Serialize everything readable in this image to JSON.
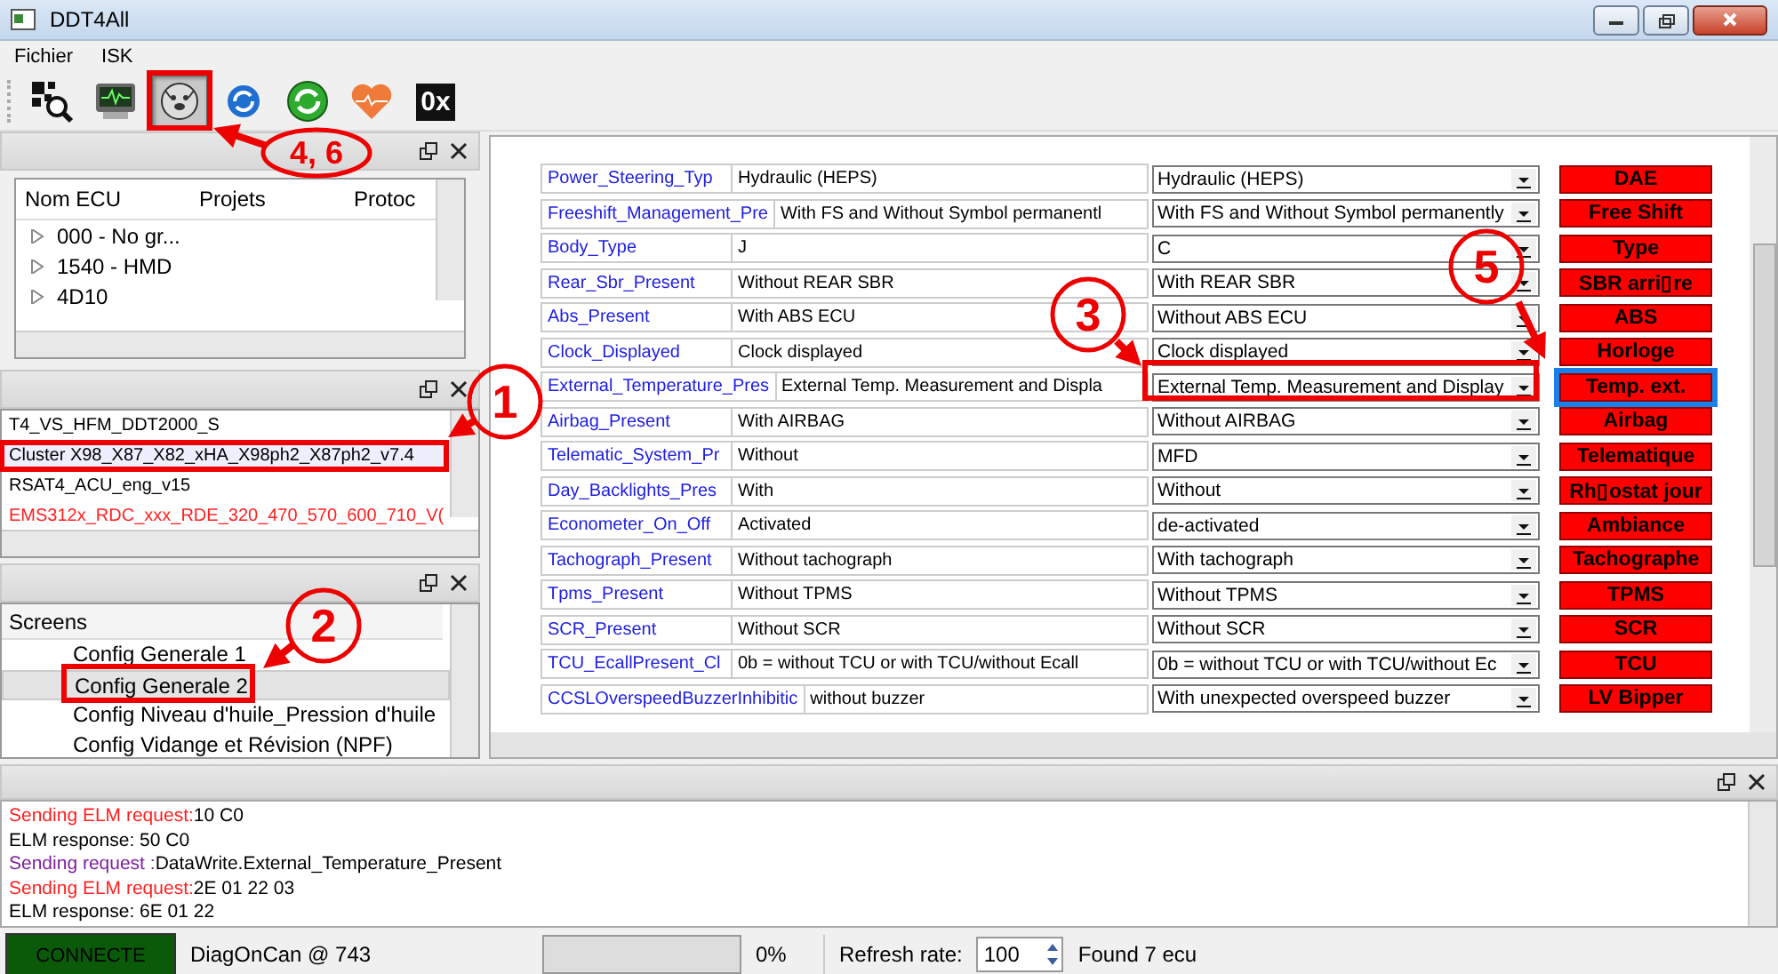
{
  "window": {
    "title": "DDT4All"
  },
  "menu": [
    "Fichier",
    "ISK"
  ],
  "toolbar": [
    {
      "kind": "scan",
      "selected": false
    },
    {
      "kind": "monitor",
      "selected": false
    },
    {
      "kind": "sniffer",
      "selected": true
    },
    {
      "kind": "refresh-blue",
      "selected": false
    },
    {
      "kind": "refresh-green",
      "selected": false
    },
    {
      "kind": "heart",
      "selected": false
    },
    {
      "kind": "hex",
      "label": "0x",
      "selected": false
    }
  ],
  "ecu_tree": {
    "columns": [
      "Nom ECU",
      "Projets",
      "Protoc"
    ],
    "rows": [
      {
        "name": "000 - No gr...",
        "expanded": false
      },
      {
        "name": "1540 - HMD",
        "expanded": false
      },
      {
        "name": "4D10",
        "expanded": false
      }
    ]
  },
  "ecu_files": [
    {
      "text": "T4_VS_HFM_DDT2000_S",
      "selected": false,
      "color": "#000000"
    },
    {
      "text": "Cluster X98_X87_X82_xHA_X98ph2_X87ph2_v7.4",
      "selected": true,
      "color": "#000000"
    },
    {
      "text": "RSAT4_ACU_eng_v15",
      "selected": false,
      "color": "#000000"
    },
    {
      "text": "EMS312x_RDC_xxx_RDE_320_470_570_600_710_V(",
      "selected": false,
      "color": "#ff2020"
    }
  ],
  "screens": {
    "header": "Screens",
    "items": [
      {
        "text": "Config Generale 1",
        "selected": false
      },
      {
        "text": "Config Generale 2",
        "selected": true
      },
      {
        "text": "Config Niveau d'huile_Pression d'huile",
        "selected": false
      },
      {
        "text": "Config Vidange et Révision (NPF)",
        "selected": false
      }
    ]
  },
  "parameters": [
    {
      "name": "Power_Steering_Typ",
      "value": "Hydraulic (HEPS)",
      "option": "Hydraulic (HEPS)",
      "button": "DAE",
      "focused": false
    },
    {
      "name": "Freeshift_Management_Pre",
      "value": "With FS and Without Symbol permanentl",
      "option": "With FS and Without Symbol permanently",
      "button": "Free Shift",
      "focused": false
    },
    {
      "name": "Body_Type",
      "value": "J",
      "option": "C",
      "button": "Type",
      "focused": false
    },
    {
      "name": "Rear_Sbr_Present",
      "value": "Without REAR SBR",
      "option": "With REAR SBR",
      "button": "SBR arri▯re",
      "focused": false
    },
    {
      "name": "Abs_Present",
      "value": "With ABS ECU",
      "option": "Without ABS ECU",
      "button": "ABS",
      "focused": false
    },
    {
      "name": "Clock_Displayed",
      "value": "Clock displayed",
      "option": "Clock displayed",
      "button": "Horloge",
      "focused": false
    },
    {
      "name": "External_Temperature_Pres",
      "value": "External Temp. Measurement and Displa",
      "option": "External Temp. Measurement and Display",
      "button": "Temp. ext.",
      "focused": true
    },
    {
      "name": "Airbag_Present",
      "value": "With AIRBAG",
      "option": "Without AIRBAG",
      "button": "Airbag",
      "focused": false
    },
    {
      "name": "Telematic_System_Pr",
      "value": "Without",
      "option": "MFD",
      "button": "Telematique",
      "focused": false
    },
    {
      "name": "Day_Backlights_Pres",
      "value": "With",
      "option": "Without",
      "button": "Rh▯ostat jour",
      "focused": false
    },
    {
      "name": "Econometer_On_Off",
      "value": "Activated",
      "option": "de-activated",
      "button": "Ambiance",
      "focused": false
    },
    {
      "name": "Tachograph_Present",
      "value": "Without tachograph",
      "option": "With tachograph",
      "button": "Tachographe",
      "focused": false
    },
    {
      "name": "Tpms_Present",
      "value": "Without TPMS",
      "option": "Without TPMS",
      "button": "TPMS",
      "focused": false
    },
    {
      "name": "SCR_Present",
      "value": "Without SCR",
      "option": "Without SCR",
      "button": "SCR",
      "focused": false
    },
    {
      "name": "TCU_EcallPresent_Cl",
      "value": "0b = without TCU or with TCU/without Ecall",
      "option": "0b = without TCU or with TCU/without Ec",
      "button": "TCU",
      "focused": false
    },
    {
      "name": "CCSLOverspeedBuzzerInhibitic",
      "value": "without buzzer",
      "option": "With unexpected overspeed buzzer",
      "button": "LV Bipper",
      "focused": false
    }
  ],
  "log": [
    {
      "kind": "request",
      "label": "Sending ELM request:",
      "text": "10 C0"
    },
    {
      "kind": "response",
      "text": "ELM response: 50 C0"
    },
    {
      "kind": "command",
      "label": "Sending request :",
      "text": "DataWrite.External_Temperature_Present"
    },
    {
      "kind": "request",
      "label": "Sending ELM request:",
      "text": "2E 01 22 03"
    },
    {
      "kind": "response",
      "text": "ELM response: 6E 01 22"
    }
  ],
  "status_bar": {
    "connection": {
      "label": "CONNECTE",
      "connected": true
    },
    "adapter": "DiagOnCan @ 743",
    "progress": {
      "level": 0,
      "reading": "0%"
    },
    "refresh_label": "Refresh rate:",
    "refresh_rate": "100",
    "found": "Found 7 ecu"
  },
  "annotations": [
    {
      "label": "4, 6"
    },
    {
      "label": "1"
    },
    {
      "label": "2"
    },
    {
      "label": "3"
    },
    {
      "label": "5"
    }
  ]
}
